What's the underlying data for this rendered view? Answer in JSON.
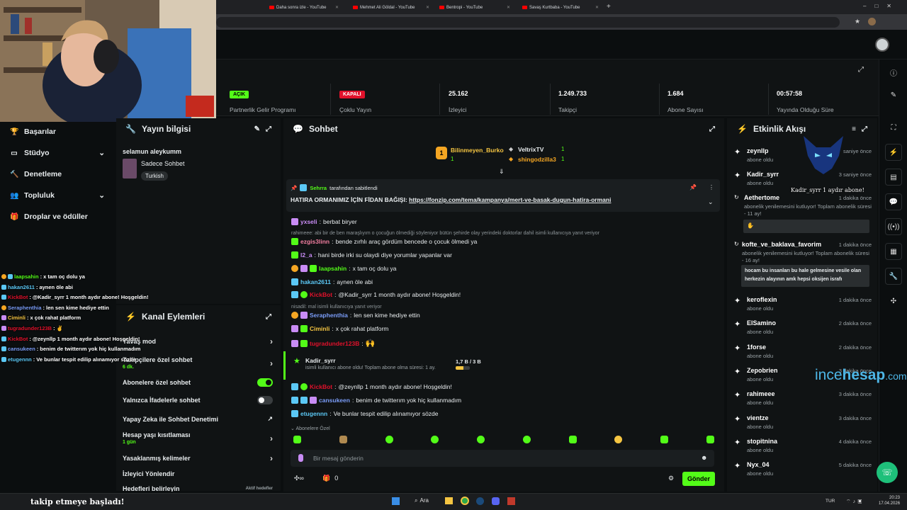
{
  "browser": {
    "tabs": [
      {
        "label": "Daha sonra izle - YouTube"
      },
      {
        "label": "Mehmet Ali Göldal - YouTube"
      },
      {
        "label": "Bentropi - YouTube"
      },
      {
        "label": "Savaş Kurtbaba - YouTube"
      }
    ]
  },
  "stats": [
    {
      "value_tag": "AÇIK",
      "label": "Partnerlik Gelir Programı"
    },
    {
      "value_tag": "KAPALI",
      "label": "Çoklu Yayın"
    },
    {
      "value": "25.162",
      "label": "İzleyici"
    },
    {
      "value": "1.249.733",
      "label": "Takipçi"
    },
    {
      "value": "1.684",
      "label": "Abone Sayısı"
    },
    {
      "value": "00:57:58",
      "label": "Yayında Olduğu Süre"
    }
  ],
  "nav": {
    "items": [
      {
        "label": "Başarılar",
        "icon": "trophy-icon"
      },
      {
        "label": "Stüdyo",
        "icon": "studio-icon"
      },
      {
        "label": "Denetleme",
        "icon": "hammer-icon"
      },
      {
        "label": "Topluluk",
        "icon": "people-icon"
      },
      {
        "label": "Droplar ve ödüller",
        "icon": "gift-icon"
      }
    ]
  },
  "stream_info": {
    "title": "Yayın bilgisi",
    "stream_title": "selamun aleykumm",
    "category": "Sadece Sohbet",
    "language": "Turkish"
  },
  "channel_actions": {
    "title": "Kanal Eylemleri",
    "rows": [
      {
        "label": "Yavaş mod",
        "sub": ""
      },
      {
        "label": "Takipçilere özel sohbet",
        "sub": "6 dk."
      },
      {
        "label": "Abonelere özel sohbet",
        "sub": ""
      },
      {
        "label": "Yalnızca İfadelerle sohbet",
        "sub": ""
      },
      {
        "label": "Yapay Zeka ile Sohbet Denetimi",
        "sub": ""
      },
      {
        "label": "Hesap yaşı kısıtlaması",
        "sub": "1 gün"
      },
      {
        "label": "Yasaklanmış kelimeler",
        "sub": ""
      },
      {
        "label": "İzleyici Yönlendir",
        "sub": ""
      },
      {
        "label": "Hedefleri belirleyin",
        "sub": "Aktif hedefler"
      }
    ]
  },
  "chat": {
    "title": "Sohbet",
    "top_gifters": [
      {
        "rank": "1",
        "name": "Bilinmeyen_Burko",
        "count": "1"
      },
      {
        "name": "VeltrixTV",
        "count": "1"
      },
      {
        "name": "shingodzilla3",
        "count": "1"
      }
    ],
    "pinned": {
      "by_user": "Sehrra",
      "by_text": "tarafından sabitlendi",
      "text": "HATIRA ORMANIMIZ İÇİN FİDAN BAĞIŞI:",
      "link": "https://fonzip.com/tema/kampanya/mert-ve-basak-dugun-hatira-ormani"
    },
    "messages": [
      {
        "user": "yxseli",
        "color": "#c98cf5",
        "text": "berbat biryer"
      },
      {
        "reply": "rahimeee: abi bir de ben maraşlıyım o çocuğun ölmediği söyleniyor bütün şehirde olay yerindeki doktorlar dahil isimli kullanıcıya yanıt veriyor"
      },
      {
        "user": "ezgis3linn",
        "color": "#f27ea0",
        "text": "bende zırhlı araç gördüm bencede o çocuk ölmedi ya"
      },
      {
        "user": "l2_a",
        "color": "#c98cf5",
        "text": "hani birde irki su olaydi diye yorumlar yapanlar var"
      },
      {
        "user": "laapsahin",
        "color": "#53fc18",
        "text": "x tam oç dolu ya"
      },
      {
        "user": "hakan2611",
        "color": "#5bc8f5",
        "text": "aynen öle abi"
      },
      {
        "user": "KickBot",
        "color": "#e0112b",
        "text": "@Kadir_syrr 1 month aydır abone! Hoşgeldin!"
      },
      {
        "reply": "nisadil: mal isimli kullanıcıya yanıt veriyor"
      },
      {
        "user": "Seraphenthia",
        "color": "#7a9cf7",
        "text": "len sen kime hediye ettin"
      },
      {
        "user": "Ciminli",
        "color": "#f5c542",
        "text": "x çok rahat platform"
      },
      {
        "user": "tugradunder123B",
        "color": "#e0112b",
        "text": ""
      },
      {
        "user": "KickBot",
        "color": "#e0112b",
        "text": "@zeynllp 1 month aydır abone! Hoşgeldin!"
      },
      {
        "user": "cansukeen",
        "color": "#7a9cf7",
        "text": "benim de twitterım yok hiç kullanmadım"
      },
      {
        "user": "etugennn",
        "color": "#5bc8f5",
        "text": "Ve bunlar tespit edilip alınamıyor sözde"
      }
    ],
    "sub_event": {
      "user": "Kadir_syrr",
      "text": "isimli kullanıcı abone oldu! Toplam abone olma süresi: 1 ay.",
      "progress_label": "1,7 B / 3 B",
      "progress": 0.57
    },
    "emote_section": "Abonelere Özel",
    "input_placeholder": "Bir mesaj gönderin",
    "count_a": "0",
    "send_label": "Gönder"
  },
  "activity": {
    "title": "Etkinlik Akışı",
    "events": [
      {
        "user": "zeynllp",
        "sub": "abone oldu",
        "time": "saniye önce"
      },
      {
        "user": "Kadir_syrr",
        "sub": "abone oldu",
        "time": "3 saniye önce"
      },
      {
        "user": "Aethertome",
        "sub": "abonelik yenilemesini kutluyor! Toplam abonelik süresi - 11 ay!",
        "time": "1 dakika önce"
      },
      {
        "user": "kofte_ve_baklava_favorim",
        "sub": "abonelik yenilemesini kutluyor! Toplam abonelik süresi - 16 ay!",
        "time": "1 dakika önce",
        "message": "hocam bu insanları bu hale gelmesine vesile olan herkezin alayının amk hepsi oksijen israfı"
      },
      {
        "user": "keroflexin",
        "sub": "abone oldu",
        "time": "1 dakika önce"
      },
      {
        "user": "ElSamino",
        "sub": "abone oldu",
        "time": "2 dakika önce"
      },
      {
        "user": "1forse",
        "sub": "abone oldu",
        "time": "2 dakika önce"
      },
      {
        "user": "Zepobrien",
        "sub": "abone oldu",
        "time": "3 dakika önce"
      },
      {
        "user": "rahimeee",
        "sub": "abone oldu",
        "time": "3 dakika önce"
      },
      {
        "user": "vientze",
        "sub": "abone oldu",
        "time": "3 dakika önce"
      },
      {
        "user": "stopitnina",
        "sub": "abone oldu",
        "time": "4 dakika önce"
      },
      {
        "user": "Nyx_04",
        "sub": "abone oldu",
        "time": "5 dakika önce"
      }
    ],
    "overlay_alert": "Kadir_syrr 1 aydır abone!"
  },
  "overlay_chat": [
    {
      "user": "laapsahin",
      "color": "#53fc18",
      "text": "x tam oç dolu ya"
    },
    {
      "user": "hakan2611",
      "color": "#5bc8f5",
      "text": "aynen öle abi"
    },
    {
      "user": "KickBot",
      "color": "#e0112b",
      "text": "@Kadir_syrr 1 month aydır abone! Hoşgeldin!"
    },
    {
      "user": "Seraphenthia",
      "color": "#7a9cf7",
      "text": "len sen kime hediye ettin"
    },
    {
      "user": "Ciminli",
      "color": "#f5c542",
      "text": "x çok rahat platform"
    },
    {
      "user": "tugradunder123B",
      "color": "#e0112b",
      "text": ""
    },
    {
      "user": "KickBot",
      "color": "#e0112b",
      "text": "@zeynllp 1 month aydır abone! Hoşgeldin!"
    },
    {
      "user": "cansukeen",
      "color": "#7a9cf7",
      "text": "benim de twitterım yok hiç kullanmadım"
    },
    {
      "user": "etugennn",
      "color": "#5bc8f5",
      "text": "Ve bunlar tespit edilip alınamıyor sözde"
    }
  ],
  "watermark": {
    "part1": "ince",
    "part2": "hesap",
    "part3": ".com"
  },
  "follow_banner": "takip etmeye başladı!",
  "taskbar": {
    "search": "Ara",
    "lang": "TUR",
    "time": "20:23",
    "date": "17.04.2026"
  }
}
